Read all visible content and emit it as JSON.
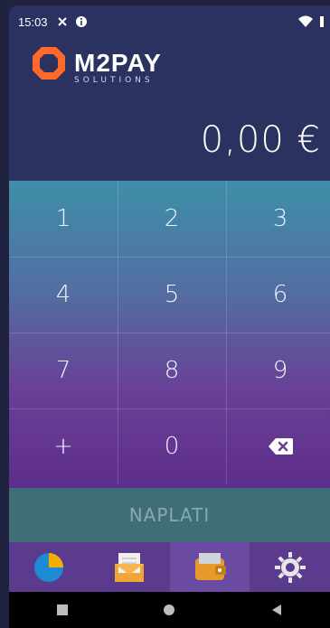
{
  "status_bar": {
    "time": "15:03",
    "icons": [
      "x-icon",
      "info-icon",
      "wifi-icon",
      "battery-icon"
    ]
  },
  "brand": {
    "name": "M2PAY",
    "tagline": "SOLUTIONS",
    "accent": "#ff6a2b"
  },
  "amount": {
    "value": "0,00 €"
  },
  "keypad": {
    "keys": [
      "1",
      "2",
      "3",
      "4",
      "5",
      "6",
      "7",
      "8",
      "9",
      "+",
      "0"
    ],
    "backspace_icon": "backspace-icon"
  },
  "pay_button": {
    "label": "NAPLATI"
  },
  "tabs": [
    {
      "icon": "pie-chart-icon"
    },
    {
      "icon": "receipt-icon"
    },
    {
      "icon": "wallet-icon"
    },
    {
      "icon": "gear-icon"
    }
  ],
  "nav": {
    "buttons": [
      "recent-icon",
      "home-icon",
      "back-icon"
    ]
  }
}
